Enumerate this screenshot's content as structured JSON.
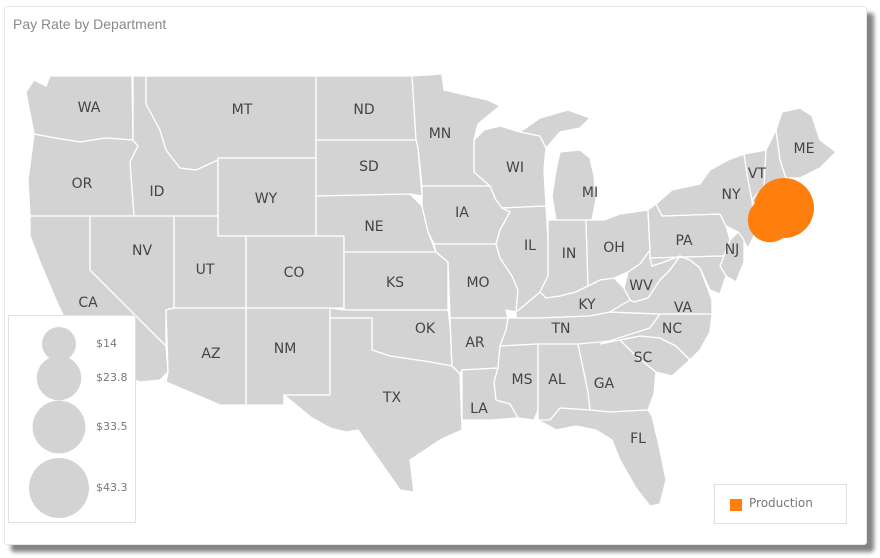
{
  "visual": {
    "title": "Pay Rate by Department",
    "map_fill": "#d3d3d3",
    "bubble_color": "#ff7f0e"
  },
  "chart_data": {
    "type": "bubble-map",
    "title": "Pay Rate by Department",
    "region": "United States",
    "states": [
      "WA",
      "OR",
      "CA",
      "ID",
      "NV",
      "MT",
      "WY",
      "UT",
      "AZ",
      "CO",
      "NM",
      "ND",
      "SD",
      "NE",
      "KS",
      "OK",
      "TX",
      "MN",
      "IA",
      "MO",
      "AR",
      "LA",
      "WI",
      "IL",
      "MI",
      "IN",
      "KY",
      "TN",
      "MS",
      "AL",
      "OH",
      "WV",
      "GA",
      "FL",
      "SC",
      "NC",
      "VA",
      "PA",
      "NY",
      "NJ",
      "VT",
      "ME"
    ],
    "size_legend": {
      "title": "",
      "entries": [
        {
          "label": "$14",
          "value": 14
        },
        {
          "label": "$23.8",
          "value": 23.8
        },
        {
          "label": "$33.5",
          "value": 33.5
        },
        {
          "label": "$43.3",
          "value": 43.3
        }
      ]
    },
    "series": [
      {
        "name": "Production",
        "color": "#ff7f0e",
        "points": [
          {
            "location": "Massachusetts / Connecticut area",
            "value": 43.3
          },
          {
            "location": "Rhode Island area",
            "value": 23.8
          }
        ]
      }
    ],
    "legend": {
      "placement": "bottom-right",
      "entries": [
        "Production"
      ]
    }
  }
}
